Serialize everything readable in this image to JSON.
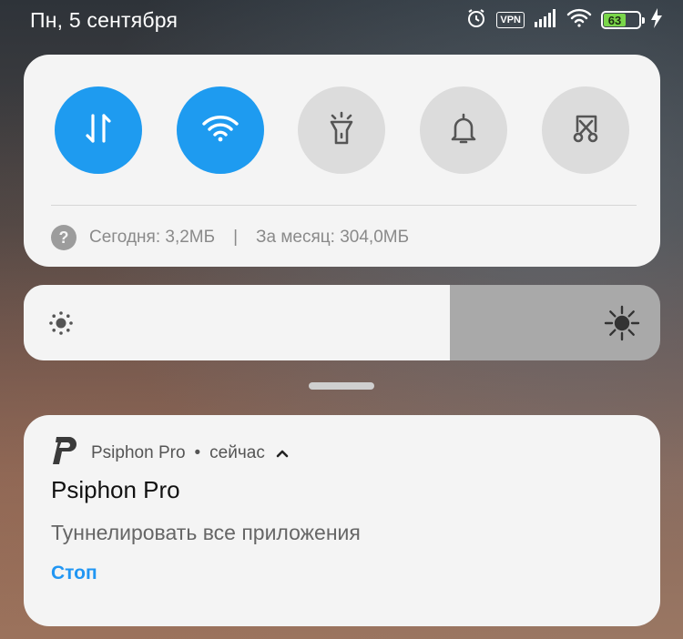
{
  "status_bar": {
    "date": "Пн, 5 сентября",
    "vpn_label": "VPN",
    "battery_level": "63",
    "battery_percent": 63,
    "icons": [
      "alarm-icon",
      "vpn-icon",
      "signal-icon",
      "wifi-icon",
      "battery-icon",
      "charging-icon"
    ]
  },
  "quick_settings": {
    "toggles": [
      {
        "id": "mobile-data",
        "icon": "mobile-data-icon",
        "active": true
      },
      {
        "id": "wifi",
        "icon": "wifi-icon",
        "active": true
      },
      {
        "id": "flashlight",
        "icon": "flashlight-icon",
        "active": false
      },
      {
        "id": "sound",
        "icon": "bell-icon",
        "active": false
      },
      {
        "id": "screenshot",
        "icon": "screenshot-scissors-icon",
        "active": false
      }
    ],
    "usage_today": "Сегодня: 3,2МБ",
    "usage_separator": "|",
    "usage_month": "За месяц: 304,0МБ",
    "help_glyph": "?"
  },
  "brightness": {
    "level_percent": 67
  },
  "notification": {
    "app_name": "Psiphon Pro",
    "separator": "•",
    "time": "сейчас",
    "title": "Psiphon Pro",
    "text": "Туннелировать все приложения",
    "action_label": "Стоп"
  },
  "colors": {
    "accent": "#1e9bf0",
    "action": "#2196f3",
    "panel": "#f4f4f4",
    "toggle_off": "#dcdcdc",
    "battery_fill": "#7ad64a"
  }
}
